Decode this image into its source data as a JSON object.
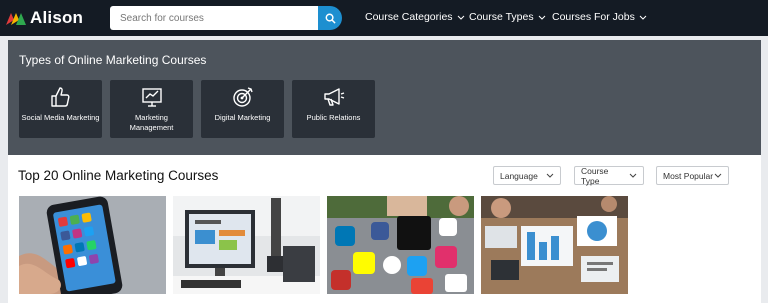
{
  "brand": {
    "name": "Alison"
  },
  "search": {
    "placeholder": "Search for courses"
  },
  "nav": [
    {
      "label": "Course Categories"
    },
    {
      "label": "Course Types"
    },
    {
      "label": "Courses For Jobs"
    }
  ],
  "categories_section": {
    "title": "Types of Online Marketing Courses",
    "items": [
      {
        "label": "Social Media Marketing",
        "icon": "thumbs-up-icon"
      },
      {
        "label": "Marketing Management",
        "icon": "chart-board-icon"
      },
      {
        "label": "Digital Marketing",
        "icon": "target-icon"
      },
      {
        "label": "Public Relations",
        "icon": "megaphone-icon"
      }
    ]
  },
  "courses_section": {
    "title": "Top 20 Online Marketing Courses",
    "filters": [
      {
        "label": "Language"
      },
      {
        "label": "Course Type"
      },
      {
        "label": "Most Popular"
      }
    ],
    "cards": [
      {
        "image": "smartphone-social-apps-image"
      },
      {
        "image": "marketing-strategy-desk-image"
      },
      {
        "image": "social-media-icons-table-image"
      },
      {
        "image": "team-charts-meeting-image"
      }
    ]
  },
  "colors": {
    "topbar": "#141b24",
    "accent": "#1d8fd0",
    "panel": "#4d545c",
    "tile": "#2a3038"
  }
}
